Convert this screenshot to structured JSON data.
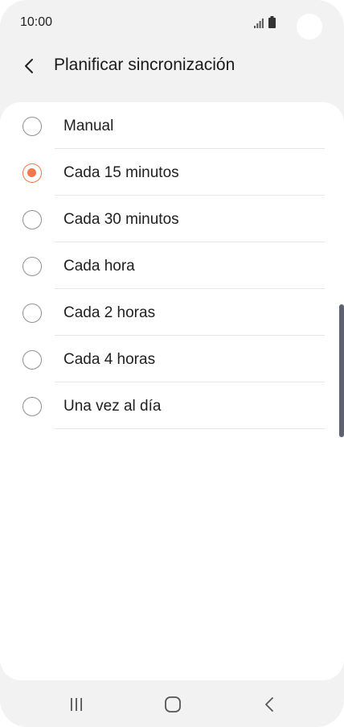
{
  "status_bar": {
    "time": "10:00",
    "signal_icon": "signal-bars-icon",
    "battery_icon": "battery-icon"
  },
  "header": {
    "back_icon": "chevron-left-icon",
    "title": "Planificar sincronización"
  },
  "options": [
    {
      "label": "Manual",
      "selected": false
    },
    {
      "label": "Cada 15 minutos",
      "selected": true
    },
    {
      "label": "Cada 30 minutos",
      "selected": false
    },
    {
      "label": "Cada hora",
      "selected": false
    },
    {
      "label": "Cada 2 horas",
      "selected": false
    },
    {
      "label": "Cada 4 horas",
      "selected": false
    },
    {
      "label": "Una vez al día",
      "selected": false
    }
  ],
  "nav_bar": {
    "recents_icon": "recents-icon",
    "home_icon": "home-icon",
    "back_icon": "back-chevron-icon"
  },
  "colors": {
    "accent": "#f2784b",
    "background": "#f2f2f2",
    "card": "#ffffff"
  }
}
